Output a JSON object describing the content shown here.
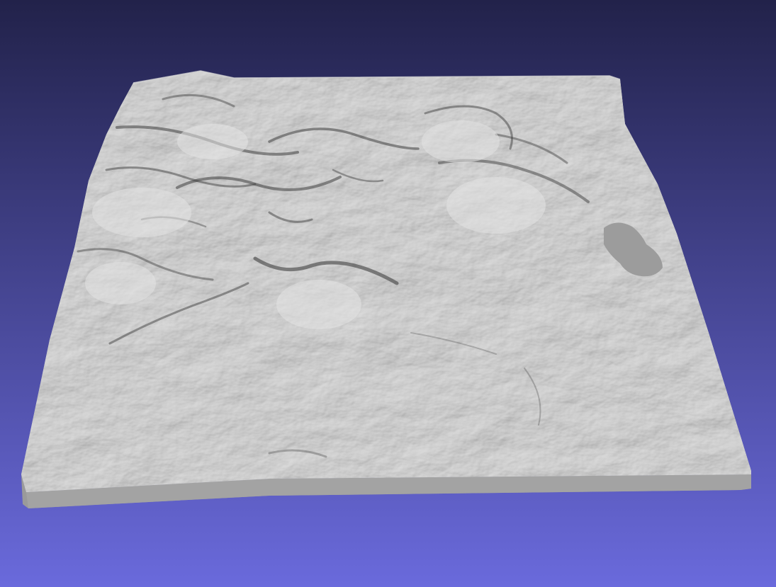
{
  "viewer": {
    "background_top_color": "#22224a",
    "background_bottom_color": "#6a6adc",
    "model": {
      "kind": "terrain-relief-mesh",
      "surface_color": "#bfbfbf",
      "side_color": "#9c9c9c",
      "features": [
        "mountain-ridges",
        "valleys",
        "lake"
      ]
    }
  }
}
